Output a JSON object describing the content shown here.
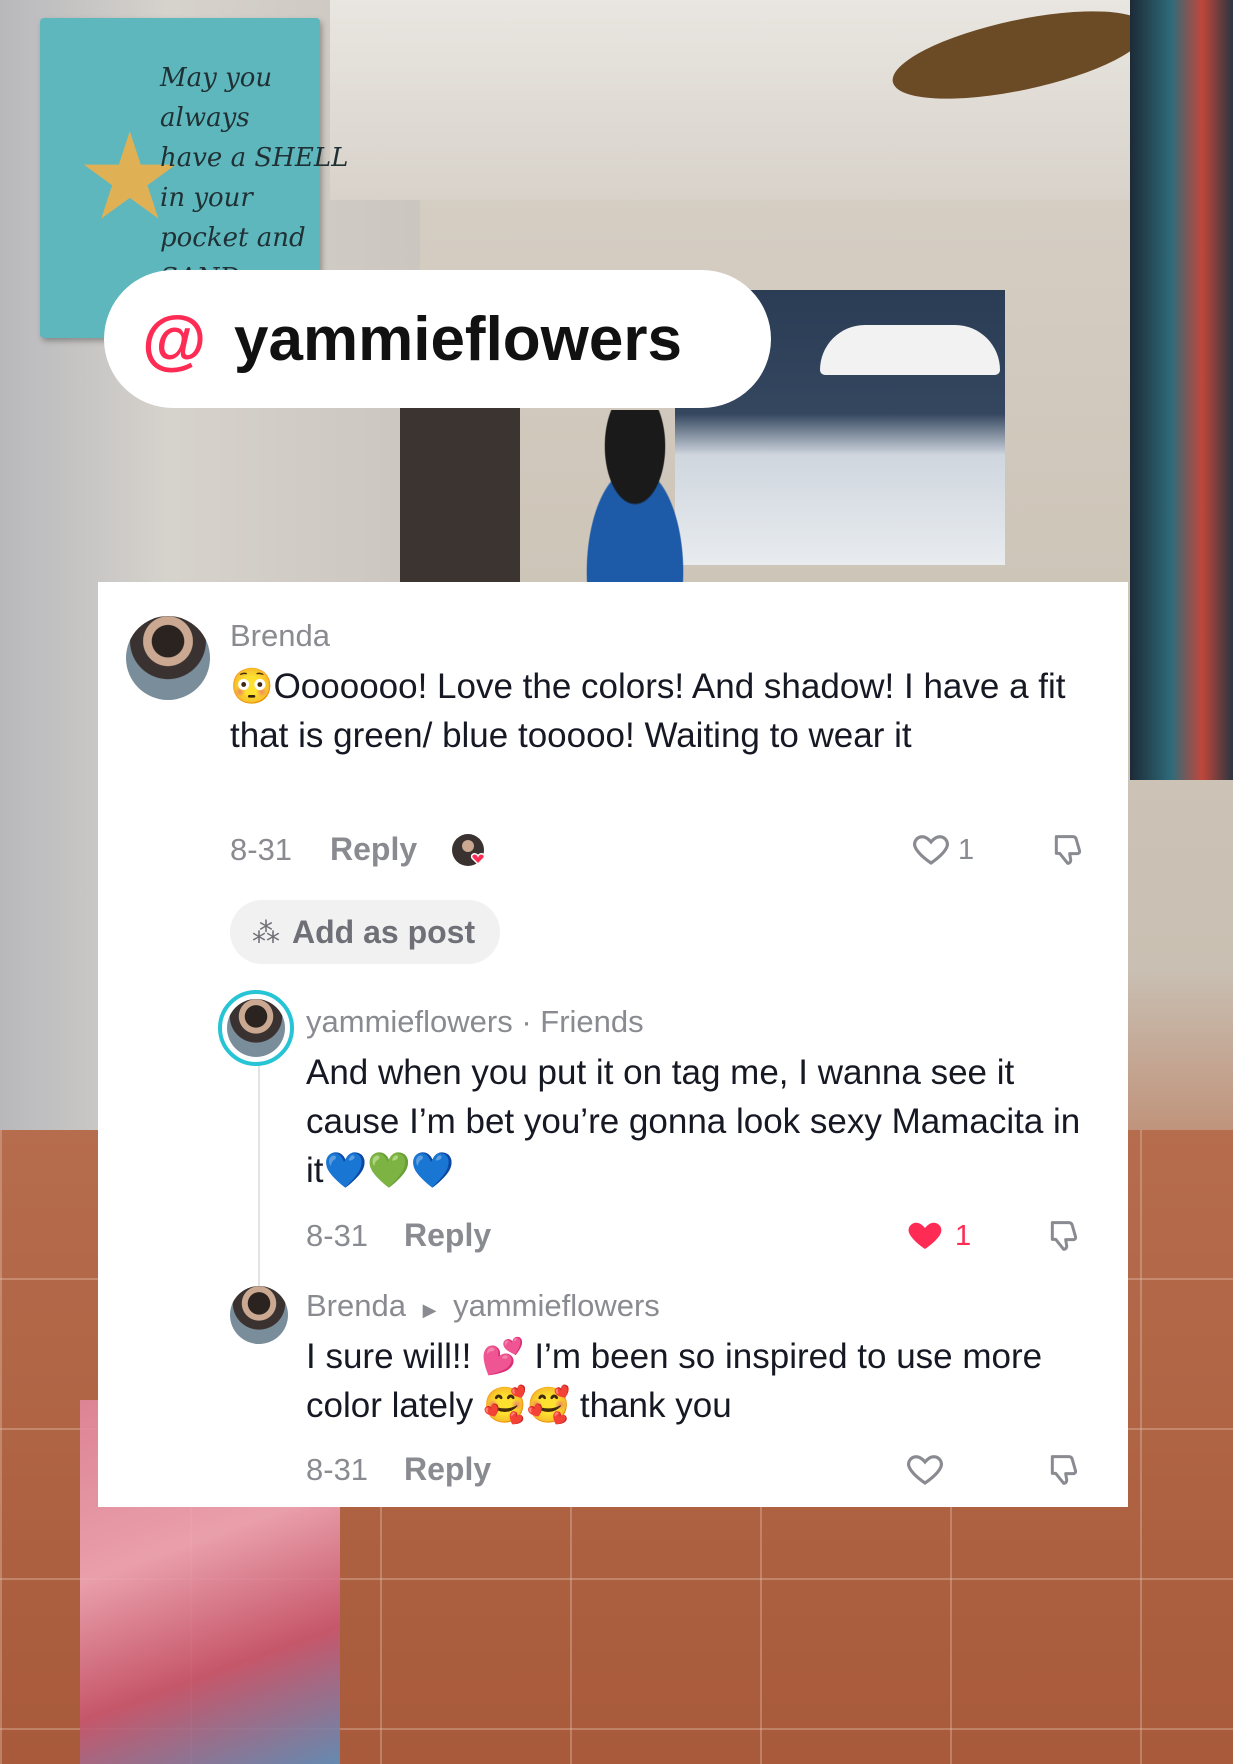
{
  "overlay": {
    "mention_symbol": "@",
    "mention_username": "yammieflowers"
  },
  "background": {
    "sign_text": [
      "May you always",
      "have a SHELL",
      "in your",
      "pocket and",
      "SAND"
    ]
  },
  "comments": [
    {
      "author": "Brenda",
      "text": "😳Ooooooo! Love the colors! And shadow! I have a fit that is green/ blue tooooo! Waiting to wear it",
      "date": "8-31",
      "reply_label": "Reply",
      "like_count": "1",
      "liked_by_creator": true,
      "add_as_post_label": "Add as post"
    },
    {
      "author": "yammieflowers · Friends",
      "text": "And when you put it on tag me, I wanna see it cause I’m bet you’re gonna look sexy Mamacita in it💙💚💙",
      "date": "8-31",
      "reply_label": "Reply",
      "like_count": "1",
      "liked": true,
      "like_color": "#fe2c55"
    },
    {
      "author": "Brenda",
      "reply_to": "yammieflowers",
      "text": "I sure will!! 💕 I’m been so inspired to use more color lately 🥰🥰 thank you",
      "date": "8-31",
      "reply_label": "Reply"
    }
  ],
  "colors": {
    "accent": "#fe2c55",
    "ring": "#27c4d6",
    "muted_text": "#8a8b91"
  },
  "icons": [
    "heart-icon",
    "dislike-icon",
    "sparkle-icon"
  ]
}
